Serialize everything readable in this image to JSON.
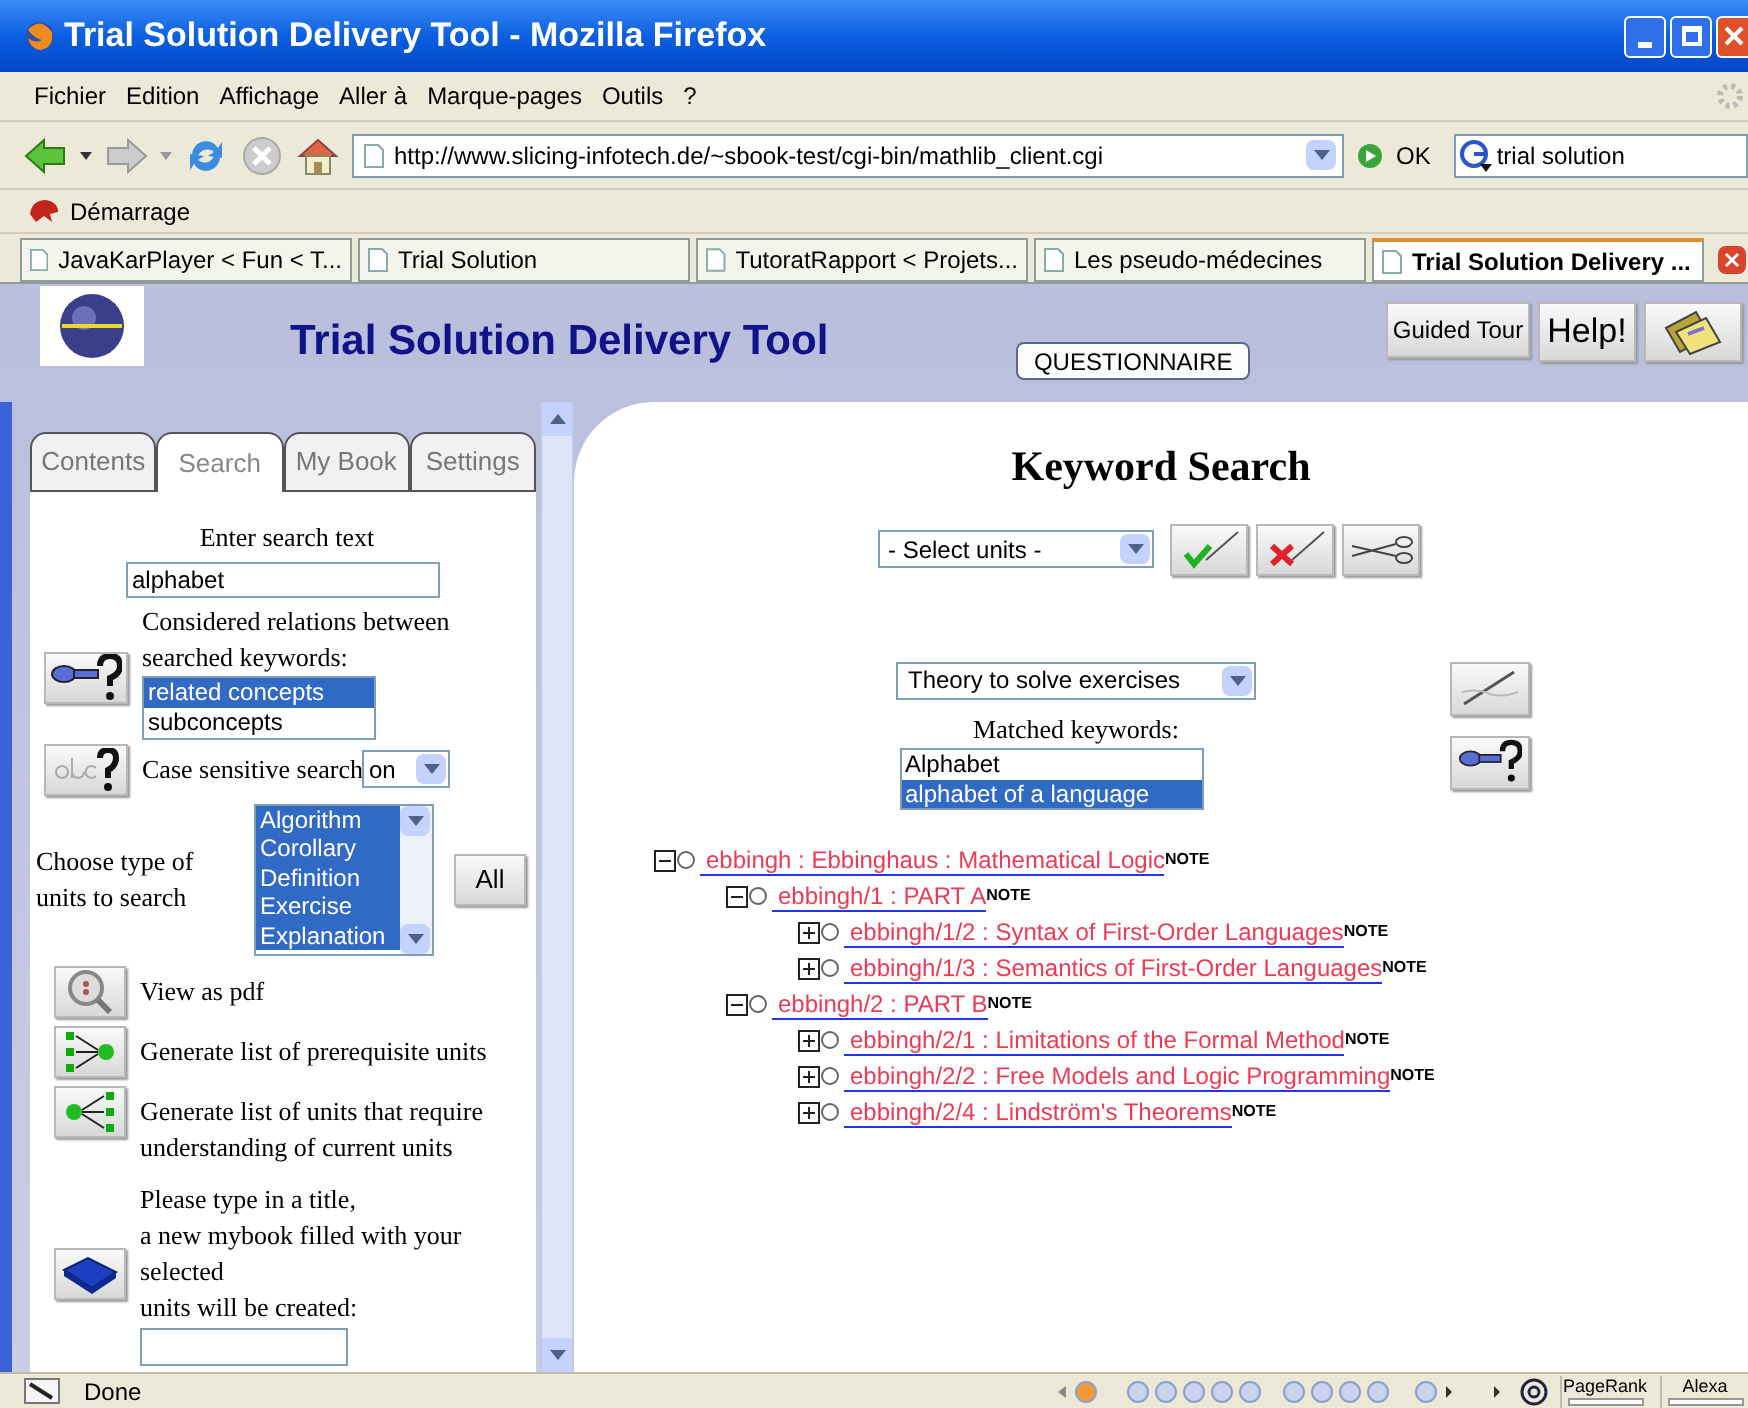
{
  "window": {
    "title": "Trial Solution Delivery Tool - Mozilla Firefox"
  },
  "menu": [
    "Fichier",
    "Edition",
    "Affichage",
    "Aller à",
    "Marque-pages",
    "Outils",
    "?"
  ],
  "navigation": {
    "url": "http://www.slicing-infotech.de/~sbook-test/cgi-bin/mathlib_client.cgi",
    "go": "OK",
    "search_value": "trial solution"
  },
  "bookmarks": [
    "Démarrage"
  ],
  "tabs": [
    {
      "label": "JavaKarPlayer < Fun < T...",
      "selected": false
    },
    {
      "label": "Trial Solution",
      "selected": false
    },
    {
      "label": "TutoratRapport < Projets...",
      "selected": false
    },
    {
      "label": "Les pseudo-médecines",
      "selected": false
    },
    {
      "label": "Trial Solution Delivery ...",
      "selected": true
    }
  ],
  "header": {
    "title": "Trial Solution Delivery Tool",
    "questionnaire": "QUESTIONNAIRE",
    "guided_tour": "Guided Tour",
    "help": "Help!"
  },
  "side_tabs": [
    {
      "label": "Contents",
      "selected": false
    },
    {
      "label": "Search",
      "selected": true
    },
    {
      "label": "My Book",
      "selected": false
    },
    {
      "label": "Settings",
      "selected": false
    }
  ],
  "search_panel": {
    "search_label": "Enter search text",
    "search_value": "alphabet",
    "relations_label": "Considered relations between searched keywords:",
    "relations": [
      {
        "label": "related concepts",
        "selected": true
      },
      {
        "label": "subconcepts",
        "selected": false
      }
    ],
    "case_label": "Case sensitive search",
    "case_value": "on",
    "unit_types_label": "Choose type of units to search",
    "unit_types": [
      {
        "label": "Algorithm",
        "selected": true
      },
      {
        "label": "Corollary",
        "selected": true
      },
      {
        "label": "Definition",
        "selected": true
      },
      {
        "label": "Exercise",
        "selected": true
      },
      {
        "label": "Explanation",
        "selected": true
      }
    ],
    "all_button": "All",
    "actions": [
      {
        "kind": "pdf",
        "label": "View as pdf"
      },
      {
        "kind": "prerequisites",
        "label": "Generate list of prerequisite units"
      },
      {
        "kind": "dependents",
        "label": "Generate list of units that require understanding of current units"
      }
    ],
    "mybook_lines": [
      "Please type in a title,",
      "a new mybook filled with your",
      "selected",
      "units will be created:"
    ]
  },
  "keyword_search": {
    "title": "Keyword Search",
    "units_select": "- Select units -",
    "purpose_select": "Theory to solve exercises",
    "matched_label": "Matched keywords:",
    "matched": [
      {
        "label": "Alphabet",
        "selected": false
      },
      {
        "label": "alphabet of a language",
        "selected": true
      }
    ]
  },
  "tree": [
    {
      "label": "ebbingh : Ebbinghaus : Mathematical Logic",
      "note": "NOTE",
      "expanded": true,
      "children": [
        {
          "label": "ebbingh/1 : PART A",
          "note": "NOTE",
          "expanded": true,
          "children": [
            {
              "label": "ebbingh/1/2 : Syntax of First-Order Languages",
              "note": "NOTE",
              "expanded": false
            },
            {
              "label": "ebbingh/1/3 : Semantics of First-Order Languages",
              "note": "NOTE",
              "expanded": false
            }
          ]
        },
        {
          "label": "ebbingh/2 : PART B",
          "note": "NOTE",
          "expanded": true,
          "children": [
            {
              "label": "ebbingh/2/1 : Limitations of the Formal Method",
              "note": "NOTE",
              "expanded": false
            },
            {
              "label": "ebbingh/2/2 : Free Models and Logic Programming",
              "note": "NOTE",
              "expanded": false
            },
            {
              "label": "ebbingh/2/4 : Lindström's Theorems",
              "note": "NOTE",
              "expanded": false
            }
          ]
        }
      ]
    }
  ],
  "status_bar": {
    "text": "Done",
    "meters": [
      "PageRank",
      "Alexa"
    ]
  }
}
